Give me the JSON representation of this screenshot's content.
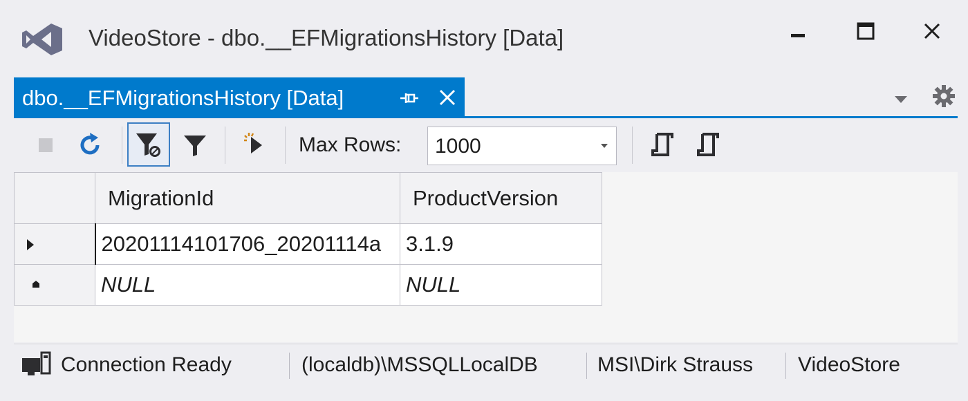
{
  "window": {
    "title": "VideoStore - dbo.__EFMigrationsHistory [Data]"
  },
  "tab": {
    "label": "dbo.__EFMigrationsHistory [Data]"
  },
  "toolbar": {
    "max_rows_label": "Max Rows:",
    "max_rows_value": "1000"
  },
  "grid": {
    "columns": [
      "MigrationId",
      "ProductVersion"
    ],
    "rows": [
      {
        "MigrationId": "20201114101706_20201114a",
        "ProductVersion": "3.1.9"
      },
      {
        "MigrationId": "NULL",
        "ProductVersion": "NULL"
      }
    ]
  },
  "status": {
    "connection": "Connection Ready",
    "server": "(localdb)\\MSSQLLocalDB",
    "user": "MSI\\Dirk Strauss",
    "database": "VideoStore"
  },
  "icons": {
    "logo": "visual-studio-logo",
    "pin": "pin-icon",
    "close": "close-icon",
    "gear": "gear-icon",
    "refresh": "refresh-icon",
    "filter": "filter-icon",
    "connection": "connection-icon"
  },
  "colors": {
    "accent": "#007acc",
    "logo": "#68217a",
    "refresh": "#1e6ec2"
  }
}
